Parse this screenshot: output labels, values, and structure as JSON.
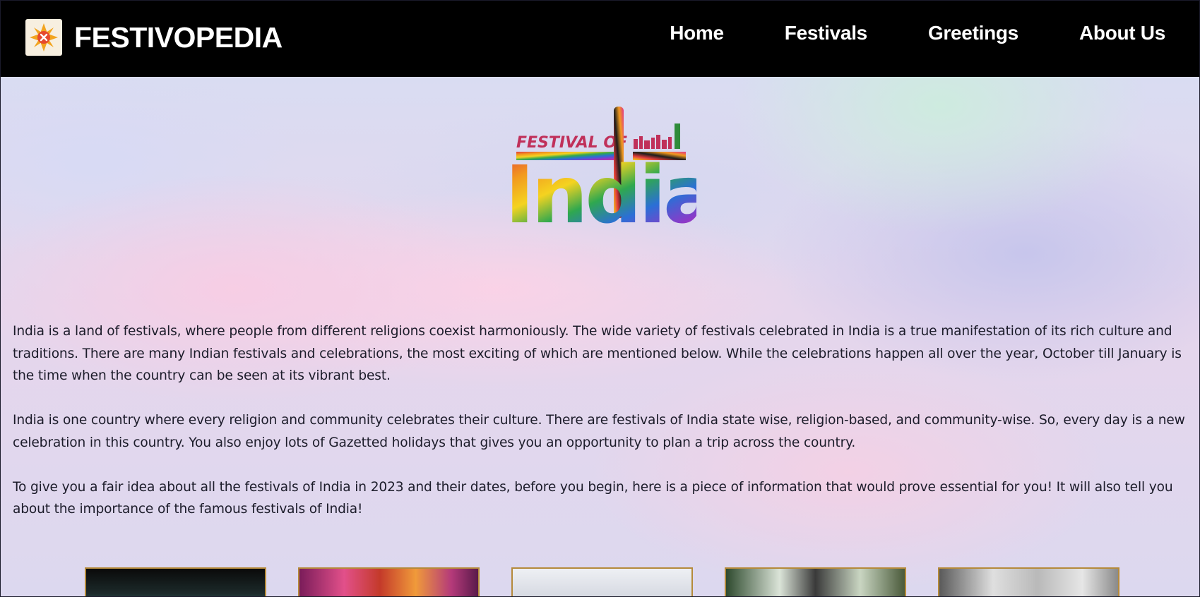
{
  "brand": {
    "name": "FESTIVOPEDIA",
    "logo_icon": "festival-star-icon"
  },
  "nav": {
    "items": [
      {
        "label": "Home"
      },
      {
        "label": "Festivals"
      },
      {
        "label": "Greetings"
      },
      {
        "label": "About Us"
      }
    ]
  },
  "hero": {
    "logo_top_text": "FESTIVAL OF",
    "logo_main_text": "India"
  },
  "intro": {
    "paragraphs": [
      "India is a land of festivals, where people from different religions coexist harmoniously. The wide variety of festivals celebrated in India is a true manifestation of its rich culture and traditions. There are many Indian festivals and celebrations, the most exciting of which are mentioned below. While the celebrations happen all over the year, October till January is the time when the country can be seen at its vibrant best.",
      "India is one country where every religion and community celebrates their culture. There are festivals of India state wise, religion-based, and community-wise. So, every day is a new celebration in this country. You also enjoy lots of Gazetted holidays that gives you an opportunity to plan a trip across the country.",
      "To give you a fair idea about all the festivals of India in 2023 and their dates, before you begin, here is a piece of information that would prove essential for you! It will also tell you about the importance of the famous festivals of India!"
    ]
  },
  "colors": {
    "navbar_bg": "#000000",
    "nav_text": "#ffffff",
    "card_border": "#b58a3a",
    "body_text": "#1c1c2a"
  }
}
